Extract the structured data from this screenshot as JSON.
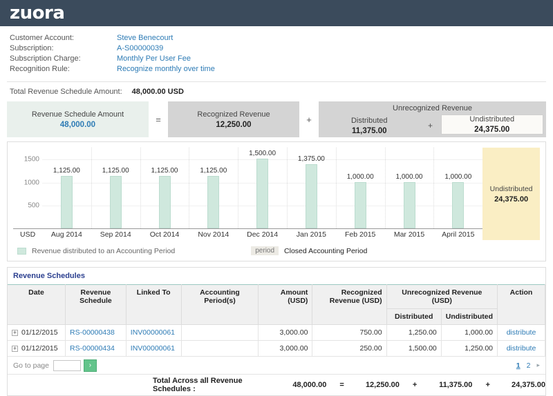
{
  "header": {
    "logo_text": "zuora"
  },
  "details": {
    "rows": [
      {
        "label": "Customer Account:",
        "value": "Steve Benecourt"
      },
      {
        "label": "Subscription:",
        "value": "A-S00000039"
      },
      {
        "label": "Subscription Charge:",
        "value": "Monthly Per User Fee"
      },
      {
        "label": "Recognition Rule:",
        "value": "Recognize monthly over time"
      }
    ],
    "total_label": "Total Revenue Schedule Amount:",
    "total_value": "48,000.00 USD"
  },
  "equation": {
    "amount_title": "Revenue Schedule Amount",
    "amount_value": "48,000.00",
    "op_equals": "=",
    "recognized_title": "Recognized Revenue",
    "recognized_value": "12,250.00",
    "op_plus": "+",
    "unrecognized_title": "Unrecognized Revenue",
    "distributed_title": "Distributed",
    "distributed_value": "11,375.00",
    "op_plus_inner": "+",
    "undistributed_title": "Undistributed",
    "undistributed_value": "24,375.00"
  },
  "chart_data": {
    "type": "bar",
    "title": "",
    "xlabel": "",
    "ylabel": "USD",
    "unit_label": "USD",
    "ylim": [
      0,
      1750
    ],
    "yticks": [
      500,
      1000,
      1500
    ],
    "ytick_labels": [
      "500",
      "1000",
      "1500"
    ],
    "grid": true,
    "categories": [
      "Aug 2014",
      "Sep 2014",
      "Oct 2014",
      "Nov 2014",
      "Dec 2014",
      "Jan 2015",
      "Feb 2015",
      "Mar 2015",
      "April 2015"
    ],
    "values": [
      1125,
      1125,
      1125,
      1125,
      1500,
      1375,
      1000,
      1000,
      1000
    ],
    "value_labels": [
      "1,125.00",
      "1,125.00",
      "1,125.00",
      "1,125.00",
      "1,500.00",
      "1,375.00",
      "1,000.00",
      "1,000.00",
      "1,000.00"
    ],
    "bar_color": "#cfe8dd",
    "undistributed_band": {
      "label": "Undistributed",
      "value": "24,375.00",
      "color": "#faeec4"
    },
    "legend": [
      {
        "type": "swatch",
        "label": "Revenue distributed to an Accounting Period"
      },
      {
        "type": "badge",
        "badge": "period",
        "label": "Closed Accounting Period"
      }
    ]
  },
  "schedules": {
    "title": "Revenue Schedules",
    "columns": {
      "date": "Date",
      "revenue_schedule": "Revenue Schedule",
      "linked_to": "Linked To",
      "accounting_periods": "Accounting Period(s)",
      "amount": "Amount (USD)",
      "recognized_revenue": "Recognized Revenue (USD)",
      "unrecognized_revenue": "Unrecognized Revenue (USD)",
      "distributed": "Distributed",
      "undistributed": "Undistributed",
      "action": "Action"
    },
    "rows": [
      {
        "expander": "+",
        "date": "01/12/2015",
        "revenue_schedule": "RS-00000438",
        "linked_to": "INV00000061",
        "accounting_periods": "",
        "amount": "3,000.00",
        "recognized_revenue": "750.00",
        "distributed": "1,250.00",
        "undistributed": "1,000.00",
        "action": "distribute"
      },
      {
        "expander": "+",
        "date": "01/12/2015",
        "revenue_schedule": "RS-00000434",
        "linked_to": "INV00000061",
        "accounting_periods": "",
        "amount": "3,000.00",
        "recognized_revenue": "250.00",
        "distributed": "1,500.00",
        "undistributed": "1,250.00",
        "action": "distribute"
      }
    ],
    "footer": {
      "goto_label": "Go to page",
      "goto_value": "",
      "goto_placeholder": "",
      "go_button": "›",
      "pages": [
        "1",
        "2"
      ],
      "current_page": "1",
      "next_arrow": "▸"
    },
    "grand_total": {
      "label": "Total Across all Revenue Schedules :",
      "amount": "48,000.00",
      "op_equals": "=",
      "recognized": "12,250.00",
      "op_plus_1": "+",
      "distributed": "11,375.00",
      "op_plus_2": "+",
      "undistributed": "24,375.00"
    }
  }
}
